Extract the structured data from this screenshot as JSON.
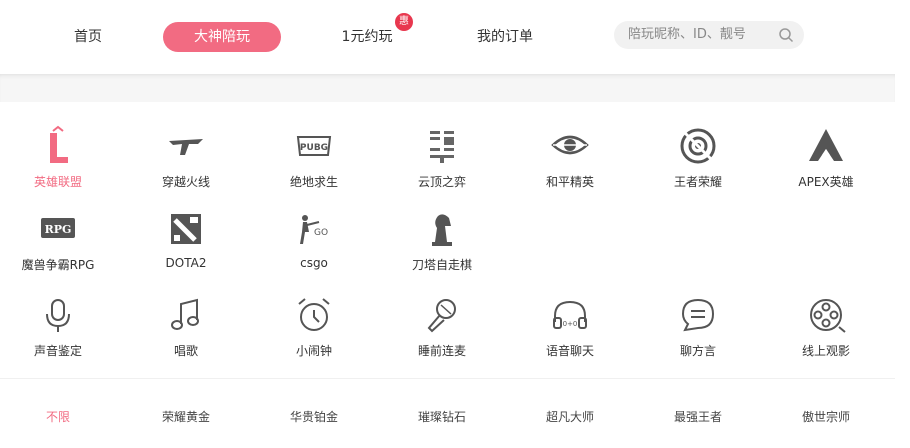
{
  "nav": {
    "home": "首页",
    "active": "大神陪玩",
    "promo": "1元约玩",
    "promo_badge": "惠",
    "orders": "我的订单",
    "search_placeholder": "陪玩昵称、ID、靓号"
  },
  "games": [
    {
      "label": "英雄联盟",
      "icon": "league-of-legends-icon"
    },
    {
      "label": "穿越火线",
      "icon": "crossfire-icon"
    },
    {
      "label": "绝地求生",
      "icon": "pubg-icon"
    },
    {
      "label": "云顶之弈",
      "icon": "teamfight-tactics-icon"
    },
    {
      "label": "和平精英",
      "icon": "peace-elite-icon"
    },
    {
      "label": "王者荣耀",
      "icon": "honor-of-kings-icon"
    },
    {
      "label": "APEX英雄",
      "icon": "apex-icon"
    },
    {
      "label": "魔兽争霸RPG",
      "icon": "warcraft-rpg-icon"
    },
    {
      "label": "DOTA2",
      "icon": "dota2-icon"
    },
    {
      "label": "csgo",
      "icon": "csgo-icon"
    },
    {
      "label": "刀塔自走棋",
      "icon": "auto-chess-icon"
    }
  ],
  "services": [
    {
      "label": "声音鉴定",
      "icon": "microphone-icon"
    },
    {
      "label": "唱歌",
      "icon": "music-note-icon"
    },
    {
      "label": "小闹钟",
      "icon": "alarm-clock-icon"
    },
    {
      "label": "睡前连麦",
      "icon": "karaoke-mic-icon"
    },
    {
      "label": "语音聊天",
      "icon": "headphones-icon"
    },
    {
      "label": "聊方言",
      "icon": "chat-bubble-icon"
    },
    {
      "label": "线上观影",
      "icon": "film-reel-icon"
    }
  ],
  "ranks": [
    "不限",
    "荣耀黄金",
    "华贵铂金",
    "璀璨钻石",
    "超凡大师",
    "最强王者",
    "傲世宗师"
  ],
  "colors": {
    "accent": "#f26b82",
    "badge": "#e8374e",
    "icon": "#555555"
  }
}
